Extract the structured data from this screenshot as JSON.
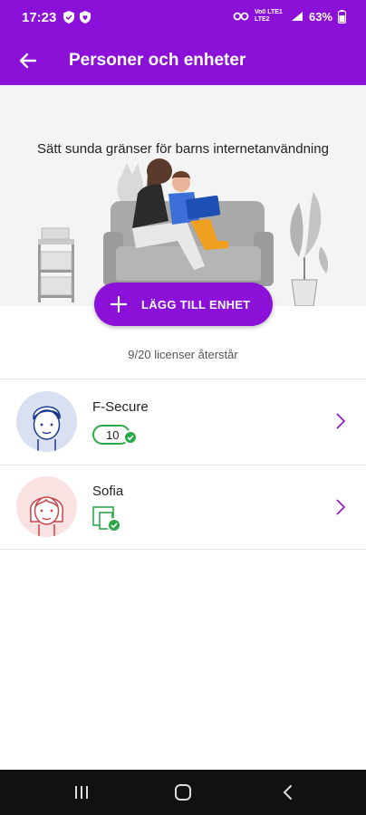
{
  "status_bar": {
    "time": "17:23",
    "network_label": "Vo0 LTE1 LTE2",
    "battery": "63%",
    "left_icons": [
      "shield-icon",
      "shield-heart-icon"
    ],
    "right_icons": [
      "key-icon",
      "signal-icon",
      "battery-icon"
    ]
  },
  "app_bar": {
    "title": "Personer och enheter",
    "back_icon": "arrow-left-icon"
  },
  "hero": {
    "text": "Sätt sunda gränser för barns internetanvändning"
  },
  "add_button": {
    "label": "LÄGG TILL ENHET",
    "icon": "plus-icon"
  },
  "licenses_text": "9/20 licenser återstår",
  "people": [
    {
      "name": "F-Secure",
      "device_count": "10",
      "avatar": "boy-face-icon",
      "status": "protected"
    },
    {
      "name": "Sofia",
      "device_count": "",
      "avatar": "girl-face-icon",
      "status": "protected"
    }
  ],
  "colors": {
    "brand": "#8b10d8",
    "success": "#2aa84a",
    "avatar_blue_bg": "#d8e0f2",
    "avatar_pink_bg": "#fbe2e2"
  }
}
